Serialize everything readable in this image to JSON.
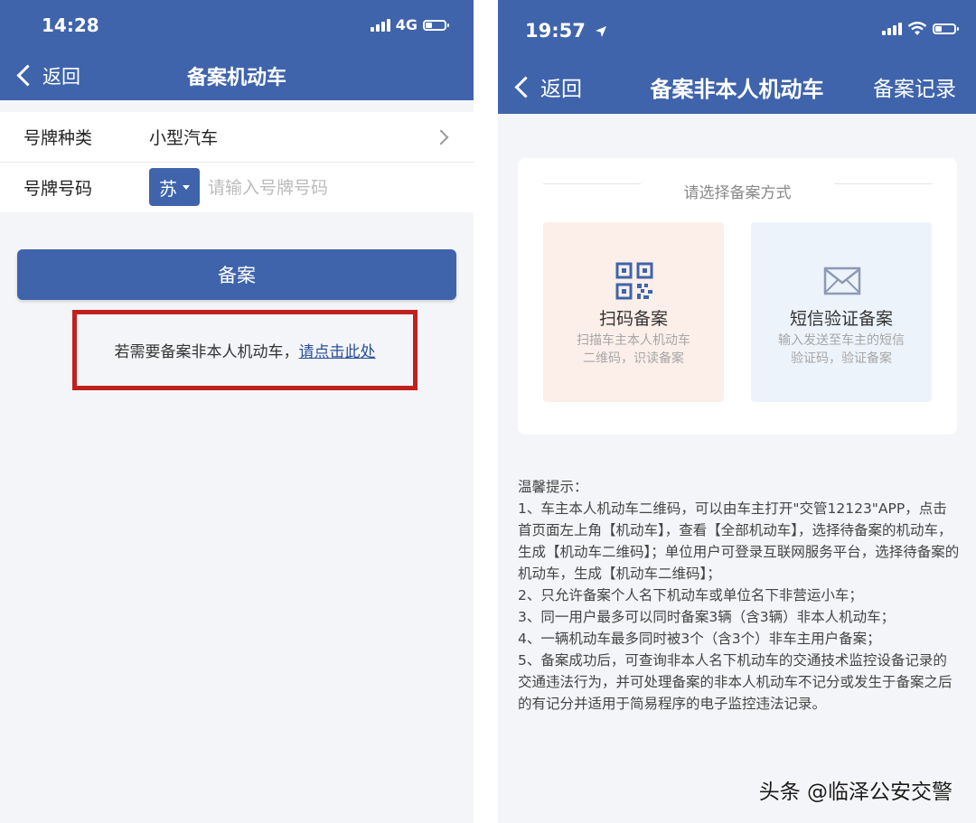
{
  "left": {
    "status": {
      "time": "14:28",
      "network": "4G"
    },
    "nav": {
      "back_label": "返回",
      "title": "备案机动车"
    },
    "form": {
      "plate_type_label": "号牌种类",
      "plate_type_value": "小型汽车",
      "plate_number_label": "号牌号码",
      "province": "苏",
      "plate_placeholder": "请输入号牌号码"
    },
    "submit_label": "备案",
    "hint": {
      "text": "若需要备案非本人机动车，",
      "link": "请点击此处"
    }
  },
  "right": {
    "status": {
      "time": "19:57"
    },
    "nav": {
      "back_label": "返回",
      "title": "备案非本人机动车",
      "records_label": "备案记录"
    },
    "card": {
      "title": "请选择备案方式",
      "options": [
        {
          "name": "扫码备案",
          "desc_line1": "扫描车主本人机动车",
          "desc_line2": "二维码，识读备案",
          "icon": "qr-code-icon",
          "bg": "#fcefe9"
        },
        {
          "name": "短信验证备案",
          "desc_line1": "输入发送至车主的短信",
          "desc_line2": "验证码，验证备案",
          "icon": "envelope-icon",
          "bg": "#edf3fb"
        }
      ]
    },
    "tips": [
      "温馨提示：",
      "1、车主本人机动车二维码，可以由车主打开\"交管12123\"APP，点击首页面左上角【机动车】，查看【全部机动车】，选择待备案的机动车，生成【机动车二维码】；单位用户可登录互联网服务平台，选择待备案的机动车，生成【机动车二维码】；",
      "2、只允许备案个人名下机动车或单位名下非营运小车；",
      "3、同一用户最多可以同时备案3辆（含3辆）非本人机动车；",
      "4、一辆机动车最多同时被3个（含3个）非车主用户备案；",
      "5、备案成功后，可查询非本人名下机动车的交通技术监控设备记录的交通违法行为，并可处理备案的非本人机动车不记分或发生于备案之后的有记分并适用于简易程序的电子监控违法记录。"
    ]
  },
  "watermark": "头条 @临泽公安交警",
  "colors": {
    "primary": "#3f64ab",
    "highlight_border": "#c1211e",
    "link": "#2a4f99"
  }
}
